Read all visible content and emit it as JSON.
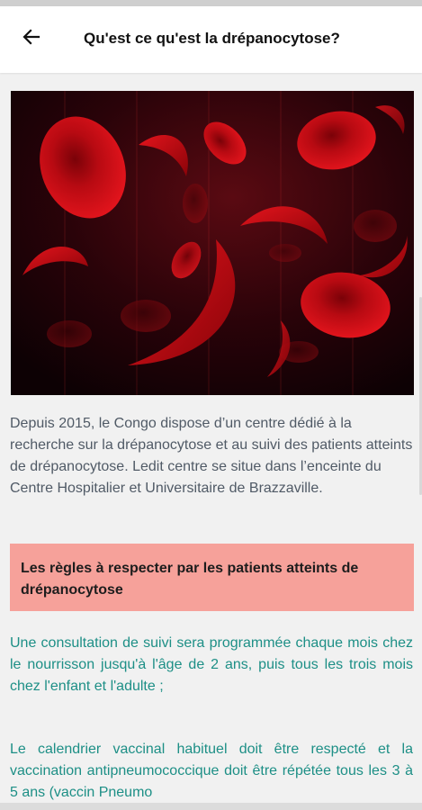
{
  "header": {
    "title": "Qu'est ce qu'est la drépanocytose?",
    "back_icon": "arrow-left-icon"
  },
  "hero_image": {
    "subject": "sickle-and-red-blood-cells"
  },
  "intro": {
    "text": "Depuis 2015, le Congo dispose d’un centre dédié à la recherche sur la drépanocytose et au suivi des patients atteints de drépanocytose.  Ledit centre se situe dans l’enceinte du Centre Hospitalier et Universitaire de Brazzaville."
  },
  "rules": {
    "heading": "Les règles à respecter par les patients atteints de drépanocytose",
    "items": [
      "Une consultation de suivi sera programmée chaque mois chez le nourrisson jusqu'à l'âge de 2 ans, puis tous les trois mois chez l'enfant et l'adulte ;",
      "Le calendrier vaccinal habituel doit être respecté et la vaccination antipneumococcique doit être répétée tous les 3 à 5 ans (vaccin Pneumo"
    ]
  },
  "colors": {
    "banner": "#f6a19a",
    "rule_text": "#1d8f86",
    "intro_text": "#505a66"
  }
}
